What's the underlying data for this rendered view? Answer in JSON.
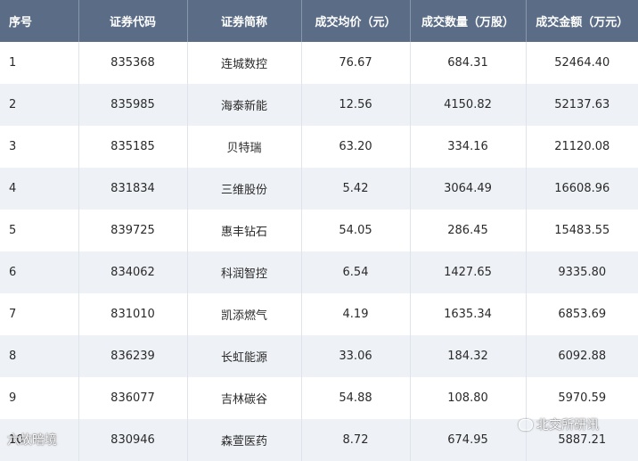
{
  "table": {
    "headers": [
      "序号",
      "证券代码",
      "证券简称",
      "成交均价（元）",
      "成交数量（万股）",
      "成交金额（万元）"
    ],
    "rows": [
      [
        "1",
        "835368",
        "连城数控",
        "76.67",
        "684.31",
        "52464.40"
      ],
      [
        "2",
        "835985",
        "海泰新能",
        "12.56",
        "4150.82",
        "52137.63"
      ],
      [
        "3",
        "835185",
        "贝特瑞",
        "63.20",
        "334.16",
        "21120.08"
      ],
      [
        "4",
        "831834",
        "三维股份",
        "5.42",
        "3064.49",
        "16608.96"
      ],
      [
        "5",
        "839725",
        "惠丰钻石",
        "54.05",
        "286.45",
        "15483.55"
      ],
      [
        "6",
        "834062",
        "科润智控",
        "6.54",
        "1427.65",
        "9335.80"
      ],
      [
        "7",
        "831010",
        "凯添燃气",
        "4.19",
        "1635.34",
        "6853.69"
      ],
      [
        "8",
        "836239",
        "长虹能源",
        "33.06",
        "184.32",
        "6092.88"
      ],
      [
        "9",
        "836077",
        "吉林碳谷",
        "54.88",
        "108.80",
        "5970.59"
      ],
      [
        "10",
        "830946",
        "森萱医药",
        "8.72",
        "674.95",
        "5887.21"
      ]
    ]
  },
  "watermarks": {
    "left": "六故暗境",
    "right": "北交所研讯"
  }
}
